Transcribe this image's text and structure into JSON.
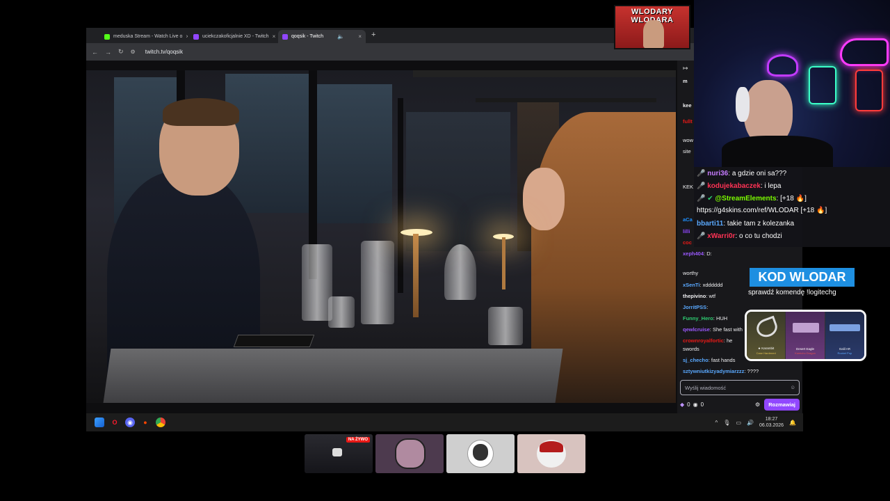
{
  "browser": {
    "tabs": [
      {
        "label": "meduska Stream - Watch Live o",
        "favicon_color": "#53fc18",
        "active": false
      },
      {
        "label": "uciekczakoficjalnie XD - Twitch",
        "favicon_color": "#9146ff",
        "active": false
      },
      {
        "label": "qoqsik - Twitch",
        "favicon_color": "#9146ff",
        "active": true
      }
    ],
    "url": "twitch.tv/qoqsik"
  },
  "twitch_chat": {
    "lines": [
      {
        "user": "m",
        "text": "",
        "color": "#efeff1"
      },
      {
        "user": "",
        "text": "kee",
        "color": "#efeff1"
      },
      {
        "user": "fullt",
        "text": "",
        "color": "#e91916"
      },
      {
        "user": "",
        "text": "wow",
        "color": "#efeff1"
      },
      {
        "user": "",
        "text": "site",
        "color": "#efeff1"
      },
      {
        "user": "",
        "text": "KEK",
        "color": "#efeff1"
      },
      {
        "user": "aCa",
        "text": "",
        "color": "#1e90ff"
      },
      {
        "user": "lilli",
        "text": "",
        "color": "#9147ff"
      },
      {
        "user": "coc",
        "text": "",
        "color": "#e91916"
      },
      {
        "user": "xeph404",
        "text": "D:",
        "color": "#9b59ff"
      },
      {
        "user": "",
        "text": "worthy",
        "color": "#efeff1"
      },
      {
        "user": "xSenTi",
        "text": "xdddddd",
        "color": "#5aa9ff"
      },
      {
        "user": "thepivino",
        "text": "wtf",
        "color": "#efeff1"
      },
      {
        "user": "JorritPSS",
        "text": "",
        "color": "#5aa9ff"
      },
      {
        "user": "Funny_Hero",
        "text": "HUH",
        "color": "#2ecc71"
      },
      {
        "user": "qewlcruise",
        "text": "She fast with",
        "color": "#9b59ff"
      },
      {
        "user": "crownroyalfortic",
        "text": "he",
        "color": "#e91916"
      },
      {
        "user": "",
        "text": "swords",
        "color": "#efeff1"
      },
      {
        "user": "sj_checho",
        "text": "fast hands",
        "color": "#5aa9ff"
      },
      {
        "user": "sztywniutkizyadymiarzzz",
        "text": "????",
        "color": "#5aa9ff"
      }
    ],
    "input_placeholder": "Wyślij wiadomość",
    "points_a": "0",
    "points_b": "0",
    "send_label": "Rozmawiaj"
  },
  "taskbar": {
    "time": "18:27",
    "date": "06.03.2026"
  },
  "overlay_chat": [
    {
      "user": "nuri36",
      "text": "a gdzie oni sa???",
      "color": "#c77dff"
    },
    {
      "user": "kodujekabaczek",
      "text": "i lepa",
      "color": "#ff3355"
    },
    {
      "user": "@StreamElements",
      "text": "[+18 🔥]",
      "color": "#7cfc00"
    },
    {
      "user": "",
      "text": "https://g4skins.com/ref/WLODAR [+18 🔥]",
      "color": "#ffffff"
    },
    {
      "user": "bbarti11",
      "text": "takie tam z kolezanka",
      "color": "#5aa9ff"
    },
    {
      "user": "xWarri0r",
      "text": "o co tu chodzi",
      "color": "#ff3355"
    }
  ],
  "promo": {
    "title": "KOD WLODAR",
    "subtitle": "sprawdź komendę !logitechg",
    "skins": [
      {
        "name": "★ Karambit",
        "sub": "Case Hardened",
        "sub_color": "#e0c050"
      },
      {
        "name": "Desert Eagle",
        "sub": "Kumicho Dragon",
        "sub_color": "#e05050"
      },
      {
        "name": "Galil AR",
        "sub": "Rocket Pop",
        "sub_color": "#5aa9ff"
      }
    ]
  },
  "logo": {
    "text": "WLODARY WLODARA"
  },
  "thumbnails": {
    "live_badge": "NA ŻYWO"
  }
}
